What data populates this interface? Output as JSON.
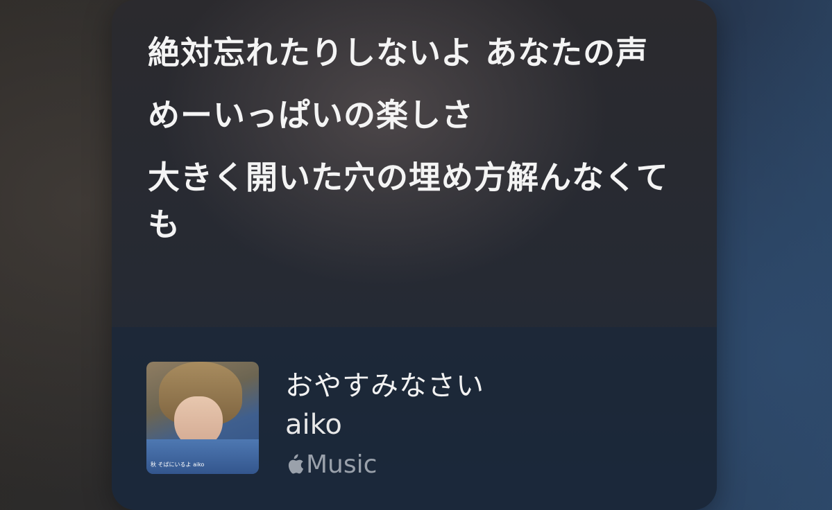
{
  "lyrics": {
    "lines": [
      "絶対忘れたりしないよ あなたの声",
      "めーいっぱいの楽しさ",
      "大きく開いた穴の埋め方解んなくても"
    ]
  },
  "now_playing": {
    "title": "おやすみなさい",
    "artist": "aiko",
    "service": "Music",
    "service_icon": "apple-logo-icon",
    "artwork_caption": "秋 そばにいるよ aiko"
  },
  "colors": {
    "text_primary": "#f4f4f4",
    "text_secondary": "#9aa1ab"
  }
}
